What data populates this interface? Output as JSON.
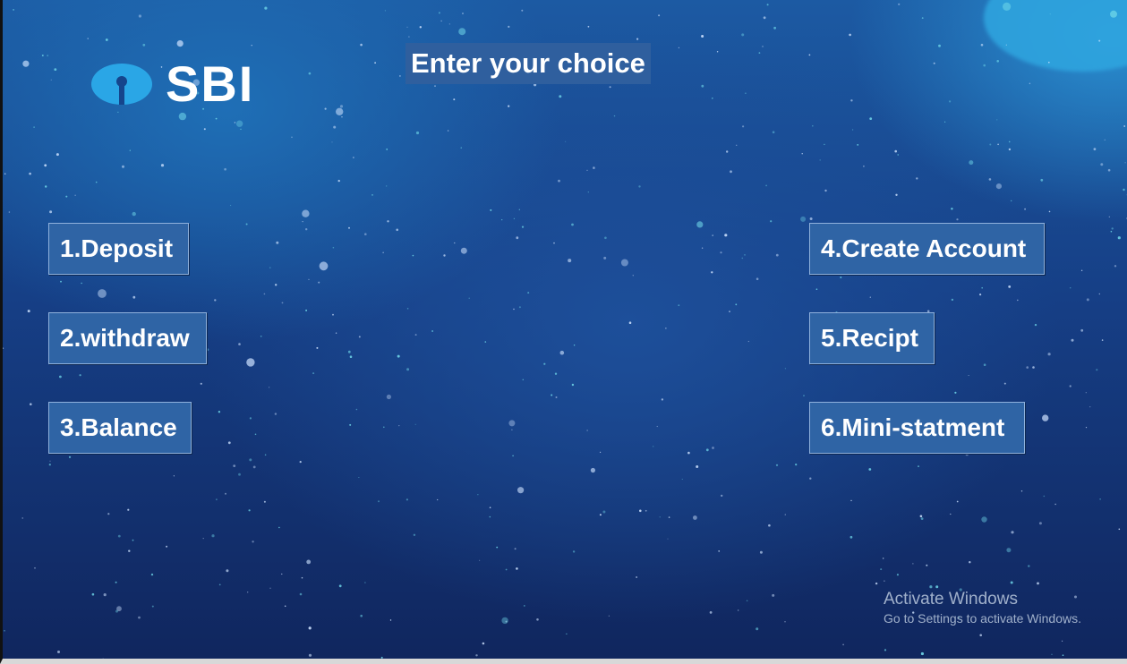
{
  "brand": {
    "logo_text": "SBI",
    "colors": {
      "logo_mark": "#2aa6e6",
      "button_bg": "#2f64a5",
      "heading_bg": "#2f5f9e",
      "text": "#ffffff"
    }
  },
  "header": {
    "title": "Enter your choice"
  },
  "menu": {
    "deposit": "1.Deposit",
    "withdraw": "2.withdraw",
    "balance": "3.Balance",
    "create_account": "4.Create Account",
    "recipt": "5.Recipt",
    "mini_statement": "6.Mini-statment"
  },
  "watermark": {
    "line1": "Activate Windows",
    "line2": "Go to Settings to activate Windows."
  }
}
